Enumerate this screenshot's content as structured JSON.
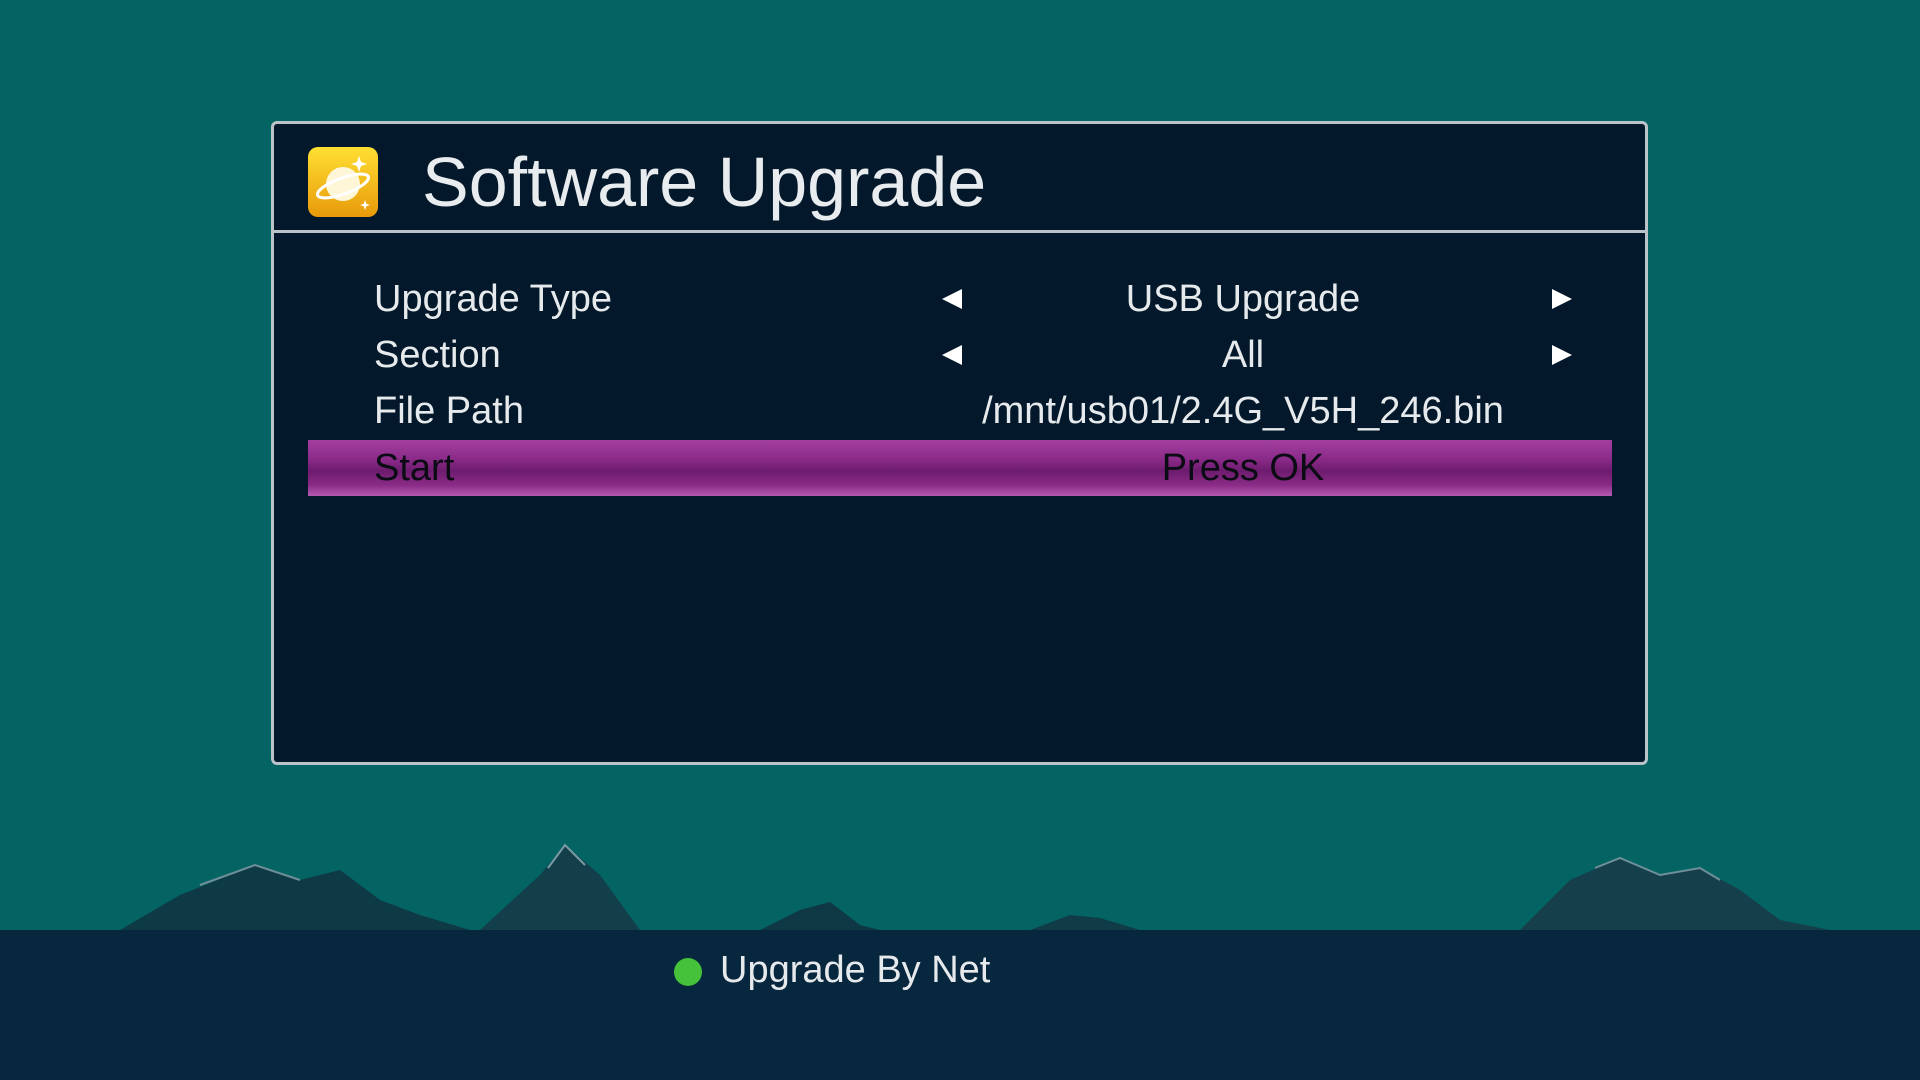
{
  "header": {
    "title": "Software Upgrade",
    "icon": "planet-icon"
  },
  "menu": {
    "rows": [
      {
        "label": "Upgrade Type",
        "value": "USB Upgrade",
        "has_arrows": true,
        "selected": false
      },
      {
        "label": "Section",
        "value": "All",
        "has_arrows": true,
        "selected": false
      },
      {
        "label": "File Path",
        "value": "/mnt/usb01/2.4G_V5H_246.bin",
        "has_arrows": false,
        "selected": false
      },
      {
        "label": "Start",
        "value": "Press OK",
        "has_arrows": false,
        "selected": true
      }
    ]
  },
  "footer": {
    "hint_color": "green",
    "hint_label": "Upgrade By Net"
  },
  "colors": {
    "background": "#046464",
    "panel": "#03192b",
    "highlight": "#8a2a88",
    "hint_dot": "#45c23a"
  }
}
